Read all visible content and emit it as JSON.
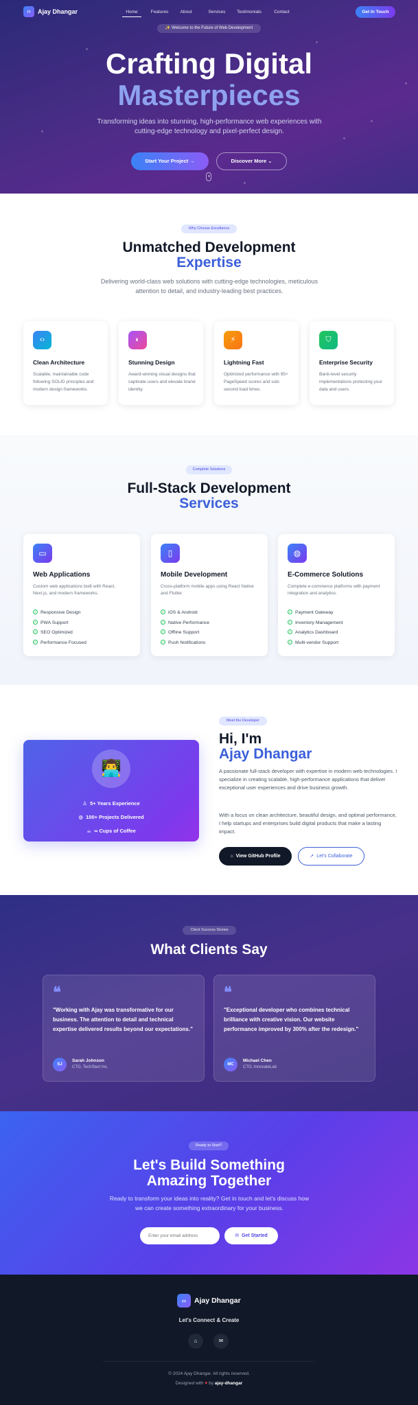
{
  "nav": {
    "logo_icon": "code-icon",
    "brand": "Ajay Dhangar",
    "links": [
      "Home",
      "Features",
      "About",
      "Services",
      "Testimonials",
      "Contact"
    ],
    "cta": "Get In Touch"
  },
  "hero": {
    "badge": "✨ Welcome to the Future of Web Development",
    "title_line1": "Crafting Digital",
    "title_line2": "Masterpieces",
    "subtitle": "Transforming ideas into stunning, high-performance web experiences with cutting-edge technology and pixel-perfect design.",
    "primary_button": "Start Your Project  →",
    "secondary_button": "Discover More  ⌄"
  },
  "features": {
    "badge": "Why Choose Excellence",
    "title_line1": "Unmatched Development",
    "title_line2": "Expertise",
    "subtitle": "Delivering world-class web solutions with cutting-edge technologies, meticulous attention to detail, and industry-leading best practices.",
    "cards": [
      {
        "icon": "code-icon",
        "glyph": "‹›",
        "color": "#3b82f6",
        "title": "Clean Architecture",
        "desc": "Scalable, maintainable code following SOLID principles and modern design frameworks."
      },
      {
        "icon": "palette-icon",
        "glyph": "◐",
        "color": "#c026d3",
        "title": "Stunning Design",
        "desc": "Award-winning visual designs that captivate users and elevate brand identity."
      },
      {
        "icon": "lightning-icon",
        "glyph": "⚡",
        "color": "#f97316",
        "title": "Lightning Fast",
        "desc": "Optimized performance with 95+ PageSpeed scores and sub-second load times."
      },
      {
        "icon": "shield-icon",
        "glyph": "⛉",
        "color": "#16a34a",
        "title": "Enterprise Security",
        "desc": "Bank-level security implementations protecting your data and users."
      }
    ]
  },
  "services": {
    "badge": "Complete Solutions",
    "title_line1": "Full-Stack Development",
    "title_line2": "Services",
    "cards": [
      {
        "icon": "monitor-icon",
        "glyph": "▭",
        "title": "Web Applications",
        "desc": "Custom web applications built with React, Next.js, and modern frameworks.",
        "items": [
          "Responsive Design",
          "PWA Support",
          "SEO Optimized",
          "Performance Focused"
        ]
      },
      {
        "icon": "smartphone-icon",
        "glyph": "▯",
        "title": "Mobile Development",
        "desc": "Cross-platform mobile apps using React Native and Flutter.",
        "items": [
          "iOS & Android",
          "Native Performance",
          "Offline Support",
          "Push Notifications"
        ]
      },
      {
        "icon": "globe-icon",
        "glyph": "◍",
        "title": "E-Commerce Solutions",
        "desc": "Complete e-commerce platforms with payment integration and analytics.",
        "items": [
          "Payment Gateway",
          "Inventory Management",
          "Analytics Dashboard",
          "Multi-vendor Support"
        ]
      }
    ]
  },
  "about": {
    "badge": "Meet the Developer",
    "avatar": "👨‍💻",
    "stats": [
      {
        "icon": "award-icon",
        "glyph": "♙",
        "text": "5+ Years Experience"
      },
      {
        "icon": "globe-icon",
        "glyph": "◍",
        "text": "100+ Projects Delivered"
      },
      {
        "icon": "coffee-icon",
        "glyph": "☕",
        "text": "∞ Cups of Coffee"
      }
    ],
    "greeting": "Hi, I'm",
    "name": "Ajay Dhangar",
    "para1": "A passionate full-stack developer with expertise in modern web technologies. I specialize in creating scalable, high-performance applications that deliver exceptional user experiences and drive business growth.",
    "para2": "With a focus on clean architecture, beautiful design, and optimal performance, I help startups and enterprises build digital products that make a lasting impact.",
    "github_button": "View GitHub Profile",
    "collab_button": "Let's Collaborate"
  },
  "testimonials": {
    "badge": "Client Success Stories",
    "title": "What Clients Say",
    "items": [
      {
        "quote": "\"Working with Ajay was transformative for our business. The attention to detail and technical expertise delivered results beyond our expectations.\"",
        "initials": "SJ",
        "name": "Sarah Johnson",
        "role": "CTO, TechStart Inc."
      },
      {
        "quote": "\"Exceptional developer who combines technical brilliance with creative vision. Our website performance improved by 300% after the redesign.\"",
        "initials": "MC",
        "name": "Michael Chen",
        "role": "CTO, InnovateLab"
      }
    ]
  },
  "cta": {
    "badge": "Ready to Start?",
    "title_line1": "Let's Build Something",
    "title_line2": "Amazing Together",
    "subtitle": "Ready to transform your ideas into reality? Get in touch and let's discuss how we can create something extraordinary for your business.",
    "email_placeholder": "Enter your email address",
    "button": "Get Started"
  },
  "footer": {
    "brand": "Ajay Dhangar",
    "tagline": "Let's Connect & Create",
    "copyright": "© 2024 Ajay Dhangar. All rights reserved.",
    "designed_prefix": "Designed with",
    "designed_by": "by",
    "designed_name": "ajay-dhangar"
  },
  "colors": {
    "accent": "#3b5fd9",
    "brand_gradient_start": "#3b82f6",
    "brand_gradient_end": "#8b5cf6"
  }
}
